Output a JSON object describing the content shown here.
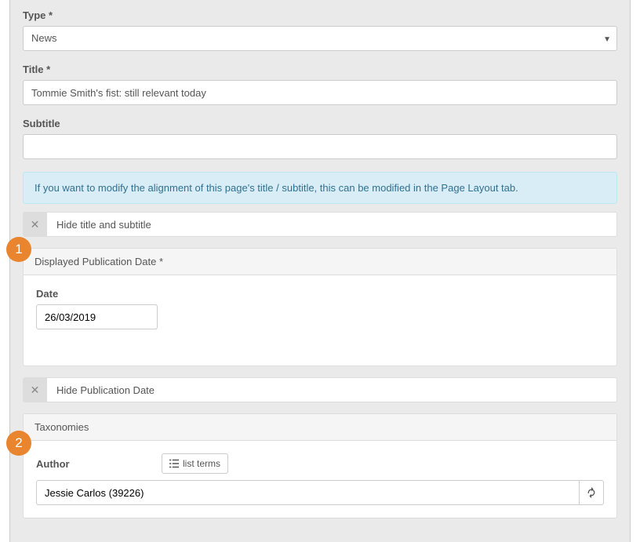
{
  "labels": {
    "type": "Type *",
    "title": "Title *",
    "subtitle": "Subtitle",
    "date": "Date",
    "author": "Author"
  },
  "values": {
    "type": "News",
    "title": "Tommie Smith's fist: still relevant today",
    "subtitle": "",
    "date": "26/03/2019",
    "author": "Jessie Carlos (39226)"
  },
  "infoBanner": "If you want to modify the alignment of this page's title / subtitle, this can be modified in the Page Layout tab.",
  "toggles": {
    "hideTitleSubtitle": "Hide title and subtitle",
    "hidePubDate": "Hide Publication Date"
  },
  "panels": {
    "displayedPubDate": "Displayed Publication Date *",
    "taxonomies": "Taxonomies"
  },
  "buttons": {
    "listTerms": "list terms"
  },
  "callouts": {
    "one": "1",
    "two": "2"
  }
}
